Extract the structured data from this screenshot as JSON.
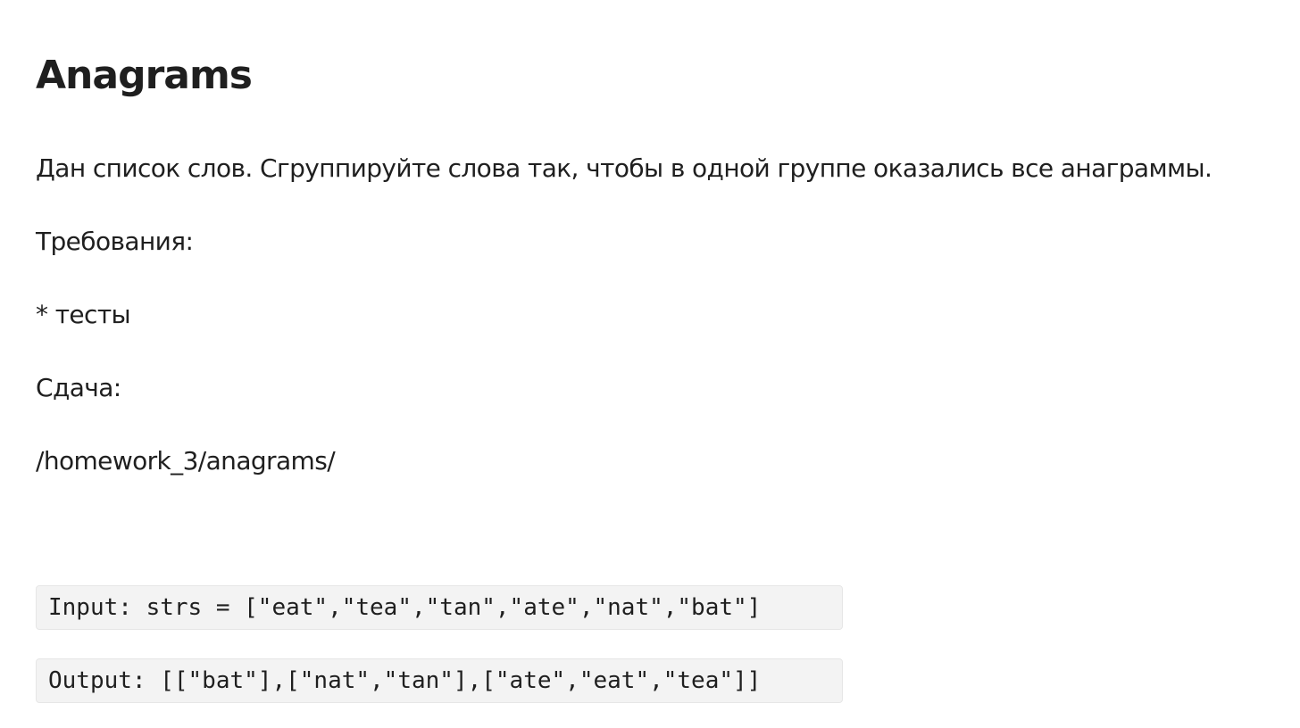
{
  "document": {
    "title": "Anagrams",
    "description": "Дан список слов. Сгруппируйте слова так, чтобы в одной группе оказались все анаграммы.",
    "requirements_heading": "Требования:",
    "requirements_item": "* тесты",
    "submission_heading": "Сдача:",
    "submission_path": "/homework_3/anagrams/",
    "example_input": "Input: strs = [\"eat\",\"tea\",\"tan\",\"ate\",\"nat\",\"bat\"]",
    "example_output": "Output: [[\"bat\"],[\"nat\",\"tan\"],[\"ate\",\"eat\",\"tea\"]]"
  }
}
